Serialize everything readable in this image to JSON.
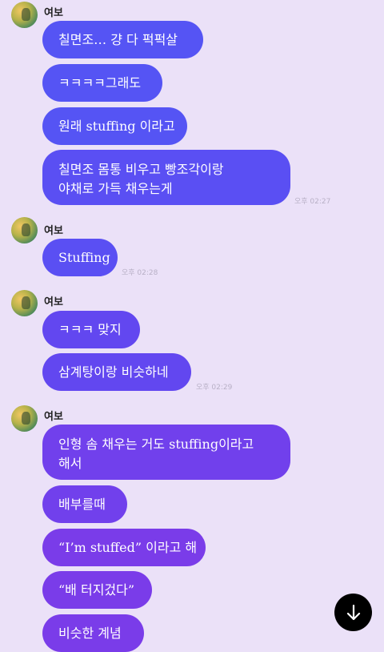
{
  "groups": [
    {
      "sender": "여보",
      "messages": [
        "칠면조… 걍 다 퍽퍽살",
        "ㅋㅋㅋㅋ그래도",
        "원래 stuffing 이라고",
        "칠면조 몸통 비우고 빵조각이랑\n야채로 가득 채우는게"
      ],
      "time": "오후 02:27"
    },
    {
      "sender": "여보",
      "messages": [
        "Stuffing"
      ],
      "time": "오후 02:28"
    },
    {
      "sender": "여보",
      "messages": [
        "ㅋㅋㅋ 맞지",
        "삼계탕이랑 비슷하네"
      ],
      "time": "오후 02:29"
    },
    {
      "sender": "여보",
      "messages": [
        "인형 솜 채우는 거도 stuffing이라고\n해서",
        "배부를때",
        "“I’m stuffed” 이라고 해",
        "“배 터지겄다”",
        "비슷한 계념"
      ]
    }
  ],
  "scroll_button": {
    "icon": "arrow-down-icon"
  },
  "colors": {
    "background": "#ebe1f8",
    "bubble_top": "#5554f4",
    "bubble_bottom": "#7a3ce9",
    "scroll_button": "#000000"
  }
}
